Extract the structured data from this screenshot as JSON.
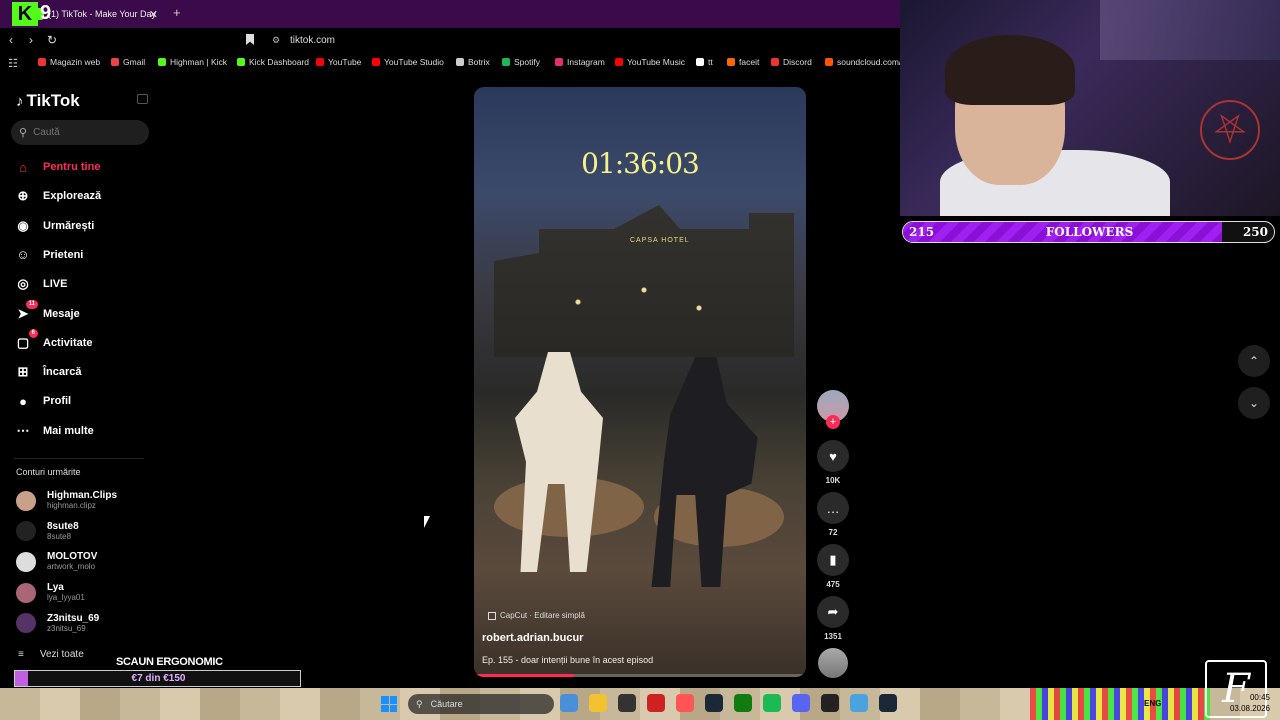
{
  "browser": {
    "tab_title": "(1) TikTok - Make Your Day",
    "tab_close": "✕",
    "new_tab": "+",
    "url": "tiktok.com",
    "overlay_logo_letter": "K",
    "overlay_logo_number": "9",
    "bookmarks": [
      {
        "label": "Magazin web",
        "color": "#e33"
      },
      {
        "label": "Gmail",
        "color": "#e44"
      },
      {
        "label": "Highman | Kick",
        "color": "#53fc18"
      },
      {
        "label": "Kick Dashboard",
        "color": "#53fc18"
      },
      {
        "label": "YouTube",
        "color": "#f00"
      },
      {
        "label": "YouTube Studio",
        "color": "#f00"
      },
      {
        "label": "Botrix",
        "color": "#ccc"
      },
      {
        "label": "Spotify",
        "color": "#1db954"
      },
      {
        "label": "Instagram",
        "color": "#e1306c"
      },
      {
        "label": "YouTube Music",
        "color": "#f00"
      },
      {
        "label": "tt",
        "color": "#fff"
      },
      {
        "label": "faceit",
        "color": "#f60"
      },
      {
        "label": "Discord",
        "color": "#e33"
      },
      {
        "label": "soundcloud.com/",
        "color": "#f50"
      }
    ]
  },
  "sidebar": {
    "brand": "TikTok",
    "search_placeholder": "Caută",
    "nav": [
      {
        "label": "Pentru tine",
        "icon": "home-icon",
        "active": true
      },
      {
        "label": "Explorează",
        "icon": "compass-icon"
      },
      {
        "label": "Urmărești",
        "icon": "following-avatar-icon"
      },
      {
        "label": "Prieteni",
        "icon": "friends-icon"
      },
      {
        "label": "LIVE",
        "icon": "live-icon"
      },
      {
        "label": "Mesaje",
        "icon": "messages-icon",
        "badge": "11"
      },
      {
        "label": "Activitate",
        "icon": "activity-icon",
        "badge": "6"
      },
      {
        "label": "Încarcă",
        "icon": "upload-icon"
      },
      {
        "label": "Profil",
        "icon": "profile-icon"
      },
      {
        "label": "Mai multe",
        "icon": "more-icon"
      }
    ],
    "following_title": "Conturi urmărite",
    "following": [
      {
        "name": "Highman.Clips",
        "handle": "highman.clipz",
        "color": "#c9a08a"
      },
      {
        "name": "8sute8",
        "handle": "8sute8",
        "color": "#222"
      },
      {
        "name": "MOLOTOV",
        "handle": "artwork_molo",
        "color": "#ddd"
      },
      {
        "name": "Lya",
        "handle": "lya_lyya01",
        "color": "#a67"
      },
      {
        "name": "Z3nitsu_69",
        "handle": "z3nitsu_69",
        "color": "#536"
      }
    ],
    "see_all": "Vezi toate"
  },
  "video": {
    "timer": "01:36:03",
    "sign_text": "CAPSA HOTEL",
    "capcut_label": "CapCut · Editare simplă",
    "author": "robert.adrian.bucur",
    "caption": "Ep. 155 - doar intenții bune în acest episod",
    "progress": 0.3
  },
  "actions": {
    "likes": "10K",
    "comments": "72",
    "saves": "475",
    "shares": "1351"
  },
  "stream": {
    "followers_current": "215",
    "followers_label": "FOLLOWERS",
    "followers_goal": "250",
    "followers_progress": 0.86,
    "donation_title": "SCAUN ERGONOMIC",
    "donation_text": "€7 din €150",
    "donation_progress": 0.047
  },
  "taskbar": {
    "search_placeholder": "Căutare",
    "tray_lang": "ENG",
    "time": "00:45",
    "date": "03.08.2026"
  }
}
